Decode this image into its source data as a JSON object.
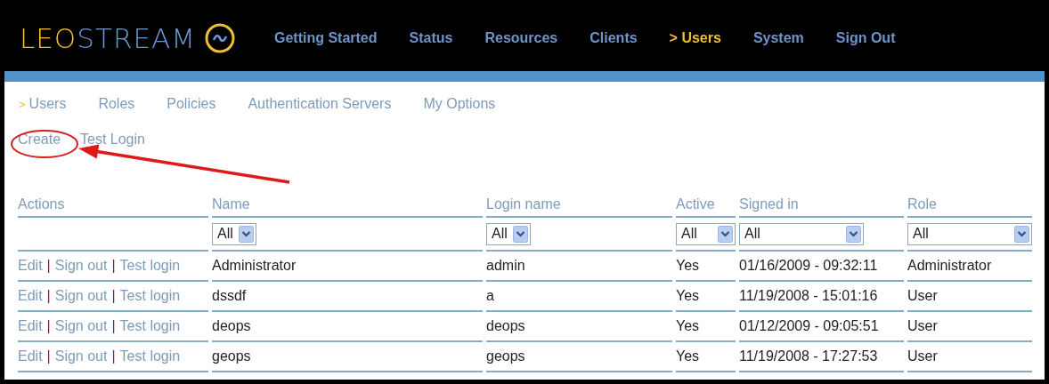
{
  "logo": {
    "part_1": "LEO",
    "part_2": "STREAM"
  },
  "nav": [
    {
      "label": "Getting Started",
      "selected": false
    },
    {
      "label": "Status",
      "selected": false
    },
    {
      "label": "Resources",
      "selected": false
    },
    {
      "label": "Clients",
      "selected": false
    },
    {
      "label": "> Users",
      "selected": true
    },
    {
      "label": "System",
      "selected": false
    },
    {
      "label": "Sign Out",
      "selected": false
    }
  ],
  "subnav": {
    "marker": ">",
    "items": [
      {
        "label": "Users",
        "selected": true
      },
      {
        "label": "Roles",
        "selected": false
      },
      {
        "label": "Policies",
        "selected": false
      },
      {
        "label": "Authentication Servers",
        "selected": false
      },
      {
        "label": "My Options",
        "selected": false
      }
    ]
  },
  "actions": [
    {
      "label": "Create",
      "circled": true
    },
    {
      "label": "Test Login",
      "circled": false
    }
  ],
  "table": {
    "columns": [
      {
        "label": "Actions"
      },
      {
        "label": "Name",
        "filter": "All"
      },
      {
        "label": "Login name",
        "filter": "All"
      },
      {
        "label": "Active",
        "filter": "All"
      },
      {
        "label": "Signed in",
        "filter": "All"
      },
      {
        "label": "Role",
        "filter": "All"
      }
    ],
    "rows": [
      {
        "cells": [
          {
            "kind": "actions",
            "parts": [
              {
                "kind": "link",
                "text": "Edit"
              },
              {
                "kind": "sep",
                "text": "|"
              },
              {
                "kind": "link",
                "text": "Sign out"
              },
              {
                "kind": "sep",
                "text": "|"
              },
              {
                "kind": "link",
                "text": "Test login"
              }
            ]
          },
          {
            "kind": "text",
            "text": "Administrator"
          },
          {
            "kind": "text",
            "text": "admin"
          },
          {
            "kind": "text",
            "text": "Yes"
          },
          {
            "kind": "text",
            "text": "01/16/2009 - 09:32:11"
          },
          {
            "kind": "text",
            "text": "Administrator"
          }
        ]
      },
      {
        "cells": [
          {
            "kind": "actions",
            "parts": [
              {
                "kind": "link",
                "text": "Edit"
              },
              {
                "kind": "sep",
                "text": "|"
              },
              {
                "kind": "link",
                "text": "Sign out"
              },
              {
                "kind": "sep",
                "text": "|"
              },
              {
                "kind": "link",
                "text": "Test login"
              }
            ]
          },
          {
            "kind": "text",
            "text": "dssdf"
          },
          {
            "kind": "text",
            "text": "a"
          },
          {
            "kind": "text",
            "text": "Yes"
          },
          {
            "kind": "text",
            "text": "11/19/2008 - 15:01:16"
          },
          {
            "kind": "text",
            "text": "User"
          }
        ]
      },
      {
        "cells": [
          {
            "kind": "actions",
            "parts": [
              {
                "kind": "link",
                "text": "Edit"
              },
              {
                "kind": "sep",
                "text": "|"
              },
              {
                "kind": "link",
                "text": "Sign out"
              },
              {
                "kind": "sep",
                "text": "|"
              },
              {
                "kind": "link",
                "text": "Test login"
              }
            ]
          },
          {
            "kind": "text",
            "text": "deops"
          },
          {
            "kind": "text",
            "text": "deops"
          },
          {
            "kind": "text",
            "text": "Yes"
          },
          {
            "kind": "text",
            "text": "01/12/2009 - 09:05:51"
          },
          {
            "kind": "text",
            "text": "User"
          }
        ]
      },
      {
        "cells": [
          {
            "kind": "actions",
            "parts": [
              {
                "kind": "link",
                "text": "Edit"
              },
              {
                "kind": "sep",
                "text": "|"
              },
              {
                "kind": "link",
                "text": "Sign out"
              },
              {
                "kind": "sep",
                "text": "|"
              },
              {
                "kind": "link",
                "text": "Test login"
              }
            ]
          },
          {
            "kind": "text",
            "text": "geops"
          },
          {
            "kind": "text",
            "text": "geops"
          },
          {
            "kind": "text",
            "text": "Yes"
          },
          {
            "kind": "text",
            "text": "11/19/2008 - 17:27:53"
          },
          {
            "kind": "text",
            "text": "User"
          }
        ]
      }
    ]
  }
}
